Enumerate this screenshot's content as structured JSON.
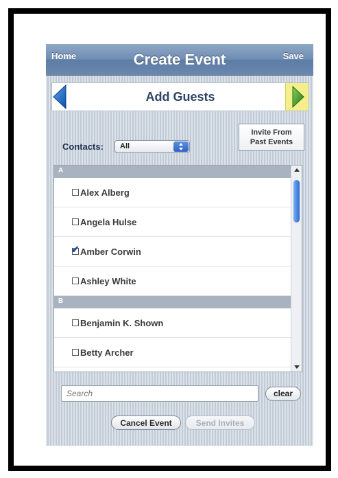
{
  "navbar": {
    "home_label": "Home",
    "title": "Create Event",
    "save_label": "Save"
  },
  "step": {
    "title": "Add Guests"
  },
  "contacts": {
    "label": "Contacts:",
    "selected": "All"
  },
  "invite_past": {
    "line1": "Invite From",
    "line2": "Past Events"
  },
  "list": {
    "sections": [
      {
        "letter": "A",
        "contacts": [
          {
            "name": "Alex Alberg",
            "checked": false
          },
          {
            "name": "Angela Hulse",
            "checked": false
          },
          {
            "name": "Amber Corwin",
            "checked": true
          },
          {
            "name": "Ashley White",
            "checked": false
          }
        ]
      },
      {
        "letter": "B",
        "contacts": [
          {
            "name": "Benjamin K. Shown",
            "checked": false
          },
          {
            "name": "Betty Archer",
            "checked": false
          }
        ]
      }
    ]
  },
  "search": {
    "placeholder": "Search",
    "clear_label": "clear"
  },
  "actions": {
    "cancel_label": "Cancel Event",
    "send_label": "Send Invites"
  },
  "colors": {
    "navbar": "#6f8db3",
    "accent_blue": "#2f63c7",
    "forward_arrow": "#3f9a2c",
    "back_arrow": "#1f6fc4",
    "forward_highlight": "#f4ef8a"
  },
  "icons": {
    "back": "left-arrow-icon",
    "forward": "right-arrow-icon",
    "select": "dropdown-arrows-icon",
    "check": "checkmark-icon"
  }
}
